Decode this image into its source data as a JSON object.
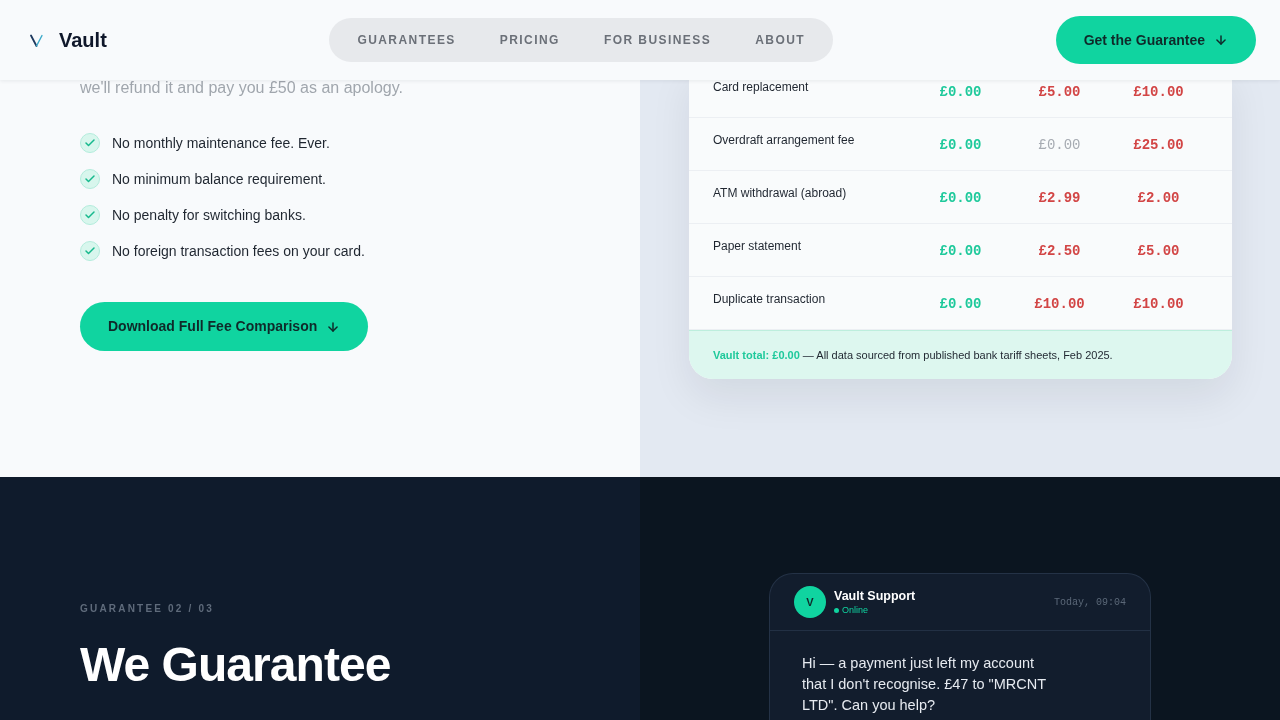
{
  "header": {
    "logo": "Vault",
    "nav": [
      {
        "label": "GUARANTEES"
      },
      {
        "label": "PRICING"
      },
      {
        "label": "FOR BUSINESS"
      },
      {
        "label": "ABOUT"
      }
    ],
    "cta": "Get the Guarantee"
  },
  "fees_section": {
    "intro_tail": "we'll refund it and pay you £50 as an apology.",
    "benefits": [
      "No monthly maintenance fee. Ever.",
      "No minimum balance requirement.",
      "No penalty for switching banks.",
      "No foreign transaction fees on your card."
    ],
    "download_button": "Download Full Fee Comparison",
    "table": {
      "rows": [
        {
          "label": "Card replacement",
          "values": [
            {
              "text": "£0.00",
              "kind": "vault"
            },
            {
              "text": "£5.00",
              "kind": "fee"
            },
            {
              "text": "£10.00",
              "kind": "fee"
            }
          ]
        },
        {
          "label": "Overdraft arrangement fee",
          "values": [
            {
              "text": "£0.00",
              "kind": "vault"
            },
            {
              "text": "£0.00",
              "kind": "free"
            },
            {
              "text": "£25.00",
              "kind": "fee"
            }
          ]
        },
        {
          "label": "ATM withdrawal (abroad)",
          "values": [
            {
              "text": "£0.00",
              "kind": "vault"
            },
            {
              "text": "£2.99",
              "kind": "fee"
            },
            {
              "text": "£2.00",
              "kind": "fee"
            }
          ]
        },
        {
          "label": "Paper statement",
          "values": [
            {
              "text": "£0.00",
              "kind": "vault"
            },
            {
              "text": "£2.50",
              "kind": "fee"
            },
            {
              "text": "£5.00",
              "kind": "fee"
            }
          ]
        },
        {
          "label": "Duplicate transaction",
          "values": [
            {
              "text": "£0.00",
              "kind": "vault"
            },
            {
              "text": "£10.00",
              "kind": "fee"
            },
            {
              "text": "£10.00",
              "kind": "fee"
            }
          ]
        }
      ],
      "footnote": "**Vault total: £0.00** — All data sourced from published bank tariff sheets, Feb 2025."
    }
  },
  "guarantee_section": {
    "eyebrow": "GUARANTEE 02 / 03",
    "heading": "We Guarantee",
    "chat": {
      "agent_initial": "V",
      "agent_name": "Vault Support",
      "status": "Online",
      "online": true,
      "time": "Today, 09:04",
      "messages": [
        {
          "text": "Hi — a payment just left my account that I don't recognise. £47 to \"MRCNT LTD\". Can you help?"
        }
      ]
    }
  }
}
